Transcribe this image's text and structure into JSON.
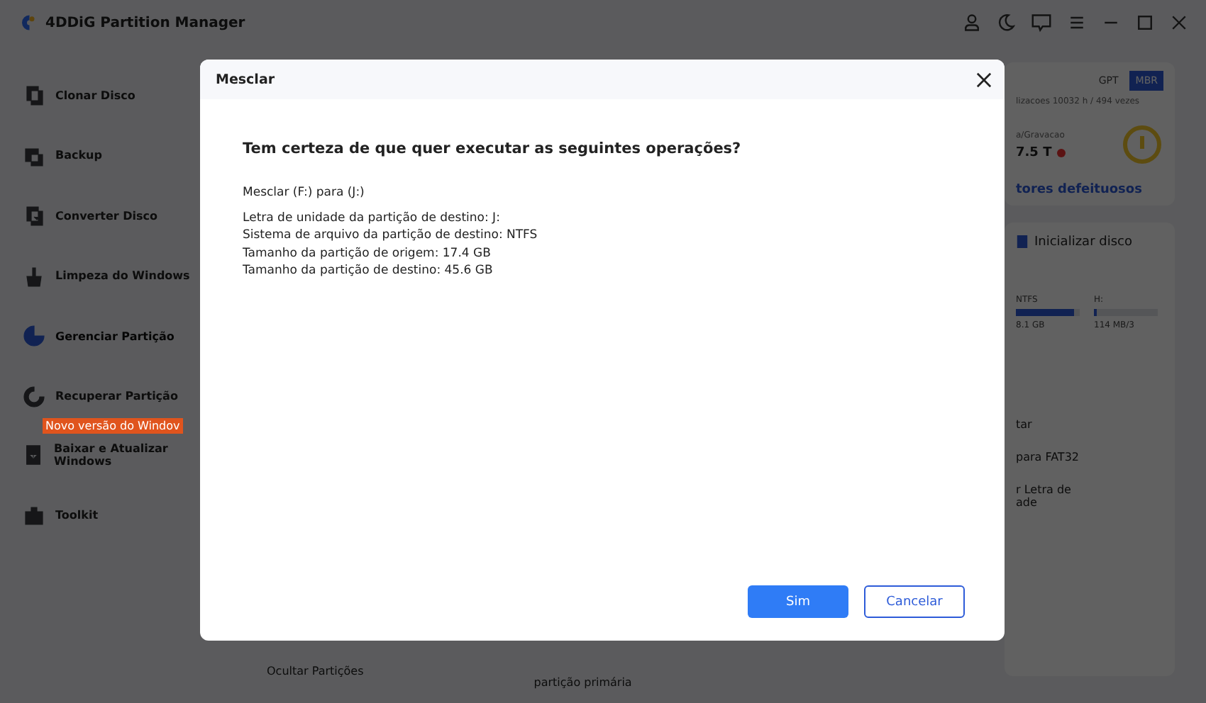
{
  "app": {
    "title": "4DDiG Partition Manager"
  },
  "sidebar": {
    "items": [
      {
        "label": "Clonar Disco",
        "selected": false
      },
      {
        "label": "Backup",
        "selected": false
      },
      {
        "label": "Converter Disco",
        "selected": false
      },
      {
        "label": "Limpeza do Windows",
        "selected": false
      },
      {
        "label": "Gerenciar Partição",
        "selected": true
      },
      {
        "label": "Recuperar Partição",
        "selected": false
      },
      {
        "label": "Baixar e Atualizar Windows",
        "selected": false,
        "badge": "Novo versão do Windov"
      },
      {
        "label": "Toolkit",
        "selected": false
      }
    ]
  },
  "background": {
    "tabs": [
      {
        "label": "GPT",
        "selected": false
      },
      {
        "label": "MBR",
        "selected": true
      }
    ],
    "usage": "lizacoes 10032 h / 494 vezes",
    "rw_label": "a/Gravacao",
    "rw_value": "7.5 T",
    "link": "tores defeituosos",
    "init_button": "Inicializar disco",
    "partitions": [
      {
        "fs": "NTFS",
        "size": "8.1 GB",
        "level": 0.9
      },
      {
        "fs": "H:",
        "size": "114 MB/3",
        "level": 0.05
      }
    ],
    "actions": [
      "tar",
      "para FAT32",
      "r Letra de\nade"
    ],
    "bottom_left": "Ocultar Partições",
    "bottom_right": "partição primária"
  },
  "dialog": {
    "title": "Mesclar",
    "question": "Tem certeza de que quer executar as seguintes operações?",
    "lines": [
      "Mesclar (F:) para (J:)",
      "Letra de unidade da partição de destino: J:",
      "Sistema de arquivo da partição de destino: NTFS",
      "Tamanho da partição de origem: 17.4 GB",
      "Tamanho da partição de destino: 45.6 GB"
    ],
    "buttons": [
      {
        "label": "Sim",
        "kind": "primary"
      },
      {
        "label": "Cancelar",
        "kind": "secondary"
      }
    ]
  }
}
